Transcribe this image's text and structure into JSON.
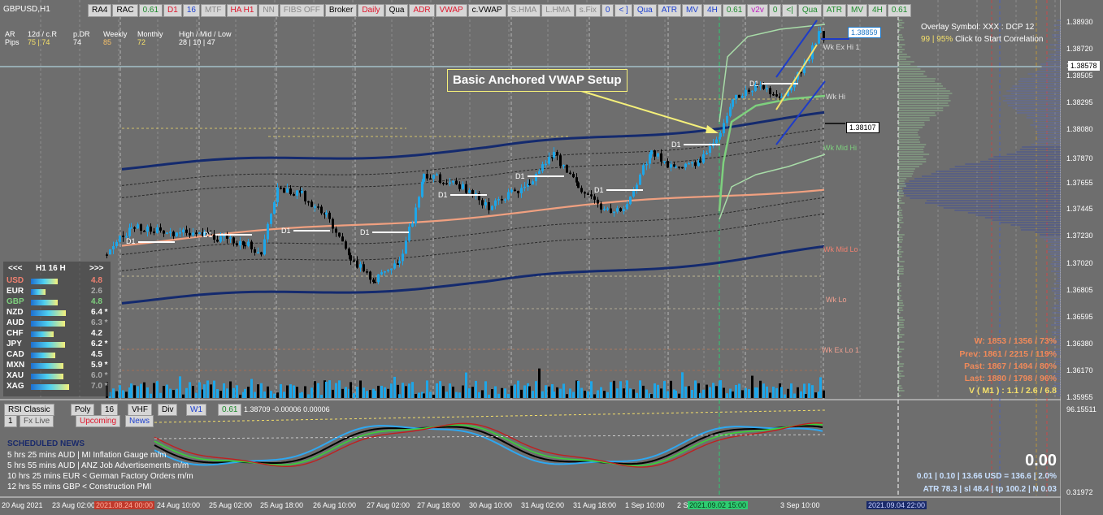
{
  "window": {
    "symbol_label": "GBPUSD,H1"
  },
  "toolbar": [
    {
      "label": "RA4",
      "color": "#000"
    },
    {
      "label": "RAC",
      "color": "#000"
    },
    {
      "label": "0.61",
      "color": "#1b8a2a"
    },
    {
      "label": "D1",
      "color": "#e0142a"
    },
    {
      "label": "16",
      "color": "#1b3fd0"
    },
    {
      "label": "MTF",
      "color": "#888"
    },
    {
      "label": "HA H1",
      "color": "#e0142a"
    },
    {
      "label": "NN",
      "color": "#888"
    },
    {
      "label": "FIBS OFF",
      "color": "#888"
    },
    {
      "label": "Broker",
      "color": "#000"
    },
    {
      "label": "Daily",
      "color": "#e0142a"
    },
    {
      "label": "Qua",
      "color": "#000"
    },
    {
      "label": "ADR",
      "color": "#e0142a"
    },
    {
      "label": "VWAP",
      "color": "#e0142a"
    },
    {
      "label": "c.VWAP",
      "color": "#000"
    },
    {
      "label": "S.HMA",
      "color": "#888"
    },
    {
      "label": "L.HMA",
      "color": "#888"
    },
    {
      "label": "s.Fix",
      "color": "#888"
    },
    {
      "label": "0",
      "color": "#1b3fd0"
    },
    {
      "label": "< ]",
      "color": "#1b3fd0"
    },
    {
      "label": "Qua",
      "color": "#1b3fd0"
    },
    {
      "label": "ATR",
      "color": "#1b3fd0"
    },
    {
      "label": "MV",
      "color": "#1b3fd0"
    },
    {
      "label": "4H",
      "color": "#1b3fd0"
    },
    {
      "label": "0.61",
      "color": "#1b8a2a"
    },
    {
      "label": "v2v",
      "color": "#c020c0"
    },
    {
      "label": "0",
      "color": "#1b8a2a"
    },
    {
      "label": "<|",
      "color": "#1b8a2a"
    },
    {
      "label": "Qua",
      "color": "#1b8a2a"
    },
    {
      "label": "ATR",
      "color": "#1b8a2a"
    },
    {
      "label": "MV",
      "color": "#1b8a2a"
    },
    {
      "label": "4H",
      "color": "#1b8a2a"
    },
    {
      "label": "0.61",
      "color": "#1b8a2a"
    }
  ],
  "stats": {
    "row1": [
      "AR",
      "12d / c.R",
      "p.DR",
      "Weekly",
      "Monthly",
      "High / Mid / Low"
    ],
    "row2": [
      "Pips",
      "75 | 74",
      "74",
      "85",
      "72",
      "28 | 10 | 47"
    ]
  },
  "overlay": {
    "line1": "Overlay Symbol: XXX : DCP 12",
    "line2_prefix": "99 | 95%",
    "line2_text": "Click to Start Correlation"
  },
  "callout": "Basic Anchored VWAP Setup",
  "price_axis": [
    "1.38930",
    "1.38720",
    "1.38578",
    "1.38505",
    "1.38295",
    "1.38080",
    "1.37870",
    "1.37655",
    "1.37445",
    "1.37230",
    "1.37020",
    "1.36805",
    "1.36595",
    "1.36380",
    "1.36170",
    "1.35955"
  ],
  "price_box_current": "1.38578",
  "price_box_high": "1.38859",
  "price_box_low": "1.38107",
  "level_tags": [
    {
      "text": "Wk Ex Hi 1",
      "color": "#dddddd"
    },
    {
      "text": "Wk Hi",
      "color": "#dddddd"
    },
    {
      "text": "Wk Mid Hi",
      "color": "#7ed07e"
    },
    {
      "text": "Wk Mid Lo",
      "color": "#f08070"
    },
    {
      "text": "Wk Lo",
      "color": "#f0a090"
    },
    {
      "text": "Wk Ex Lo 1",
      "color": "#f0a090"
    }
  ],
  "d1_labels": [
    "D1",
    "D1",
    "D1",
    "D1",
    "D1",
    "D1",
    "D1",
    "D1",
    "D1"
  ],
  "time_axis": [
    "20 Aug 2021",
    "23 Aug 02:00",
    "2021.08.24 00:00",
    "24 Aug 10:00",
    "25 Aug 02:00",
    "25 Aug 18:00",
    "26 Aug 10:00",
    "27 Aug 02:00",
    "27 Aug 18:00",
    "30 Aug 10:00",
    "31 Aug 02:00",
    "31 Aug 18:00",
    "1 Sep 10:00",
    "2 S",
    "2021.09.02 15:00",
    "3 Sep 10:00",
    "2021.09.04 22:00"
  ],
  "strength": {
    "header": {
      "left": "<<<",
      "mid": "H1  16  H",
      "right": ">>>"
    },
    "rows": [
      {
        "name": "USD",
        "value": "4.8",
        "name_color": "#f08070",
        "value_color": "#f08070",
        "bar": 0.65
      },
      {
        "name": "EUR",
        "value": "2.6",
        "name_color": "#ffffff",
        "value_color": "#aaaaaa",
        "bar": 0.35
      },
      {
        "name": "GBP",
        "value": "4.8",
        "name_color": "#7ed07e",
        "value_color": "#7ed07e",
        "bar": 0.65
      },
      {
        "name": "NZD",
        "value": "6.4 *",
        "name_color": "#ffffff",
        "value_color": "#ffffff",
        "bar": 0.85
      },
      {
        "name": "AUD",
        "value": "6.3 *",
        "name_color": "#ffffff",
        "value_color": "#aaaaaa",
        "bar": 0.84
      },
      {
        "name": "CHF",
        "value": "4.2",
        "name_color": "#ffffff",
        "value_color": "#ffffff",
        "bar": 0.56
      },
      {
        "name": "JPY",
        "value": "6.2 *",
        "name_color": "#ffffff",
        "value_color": "#ffffff",
        "bar": 0.83
      },
      {
        "name": "CAD",
        "value": "4.5",
        "name_color": "#ffffff",
        "value_color": "#ffffff",
        "bar": 0.6
      },
      {
        "name": "MXN",
        "value": "5.9 *",
        "name_color": "#ffffff",
        "value_color": "#ffffff",
        "bar": 0.79
      },
      {
        "name": "XAU",
        "value": "6.0 *",
        "name_color": "#ffffff",
        "value_color": "#aaaaaa",
        "bar": 0.8
      },
      {
        "name": "XAG",
        "value": "7.0 *",
        "name_color": "#ffffff",
        "value_color": "#aaaaaa",
        "bar": 0.93
      }
    ]
  },
  "rsi_panel": {
    "buttons": [
      "RSI Classic",
      "Poly",
      "16",
      "VHF",
      "Div",
      "W1",
      "0.61"
    ],
    "readout": "1.38709 -0.00006 0.00006",
    "axis_top": "96.15511",
    "axis_bottom": "0.31972",
    "tabs": [
      "1",
      "Fx Live",
      "Upcoming",
      "News"
    ]
  },
  "news": {
    "title": "SCHEDULED NEWS",
    "items": [
      "5 hrs 25 mins  AUD  |  MI Inflation Gauge m/m",
      "5 hrs 55 mins  AUD  |  ANZ Job Advertisements m/m",
      "10 hrs 25 mins  EUR  <  German Factory Orders m/m",
      "12 hrs 55 mins  GBP  <  Construction PMI"
    ]
  },
  "right_stats": {
    "w": "W: 1853 / 1356 / 73%",
    "prev": "Prev: 1861 / 2215 / 119%",
    "past": "Past: 1867 / 1494 / 80%",
    "last": "Last: 1880 / 1798 / 96%",
    "v": "V ( M1 ) : 1.1 / 2.6 / 6.8",
    "big": "0.00",
    "line1": "0.01  |  0.10  |  13.66 USD = 136.6  |  2.0%",
    "line2": "ATR 78.3  | sl 48.4  |  tp 100.2  |  N 0.03"
  },
  "colors": {
    "background": "#6e6e6e",
    "bull": "#1ea6e8",
    "bear": "#000000",
    "vwap_main": "#142a6e",
    "vwap_salmon": "#f0a080",
    "anchored": "#7ed07e",
    "callout_border": "#f5f07a"
  }
}
